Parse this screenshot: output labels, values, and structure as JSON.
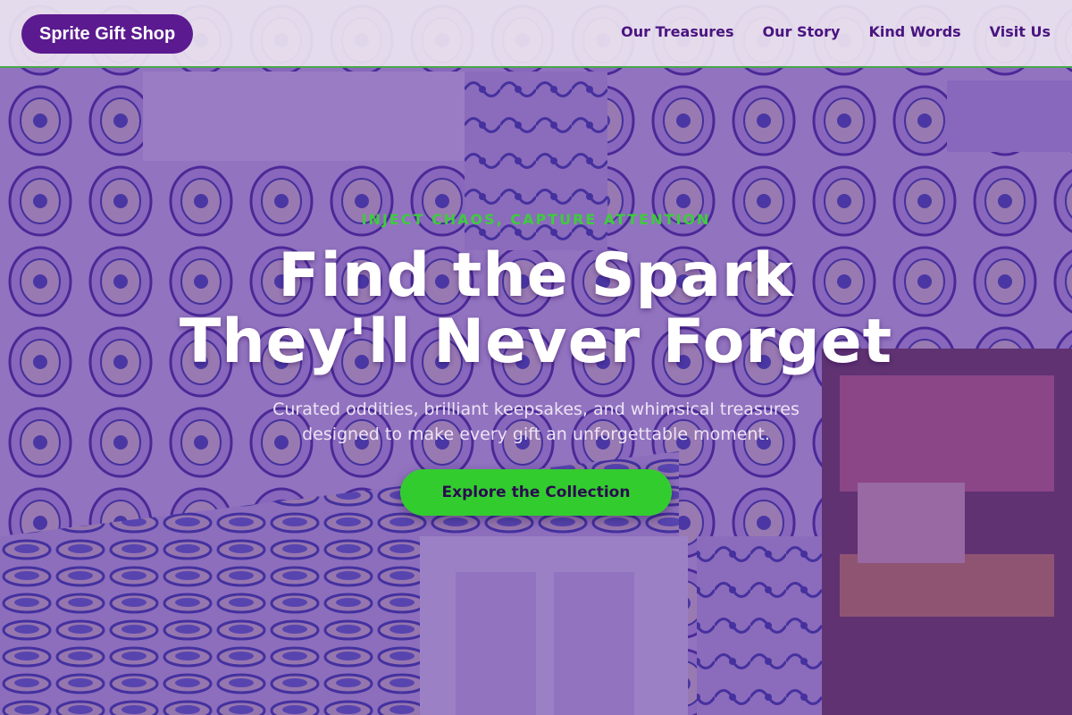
{
  "header": {
    "brand": "Sprite Gift Shop",
    "nav": [
      {
        "label": "Our Treasures"
      },
      {
        "label": "Our Story"
      },
      {
        "label": "Kind Words"
      },
      {
        "label": "Visit Us"
      }
    ]
  },
  "hero": {
    "eyebrow": "INJECT CHAOS, CAPTURE ATTENTION",
    "headline_line1": "Find the Spark",
    "headline_line2": "They'll Never Forget",
    "subtext_line1": "Curated oddities, brilliant keepsakes, and whimsical treasures",
    "subtext_line2": "designed to make every gift an unforgettable moment.",
    "cta_label": "Explore the Collection"
  },
  "colors": {
    "brand_purple": "#5b1a8f",
    "nav_text": "#4a1480",
    "accent_green": "#33cc2f",
    "eyebrow_green": "#3dcc3d",
    "overlay_purple": "#5828a0"
  }
}
